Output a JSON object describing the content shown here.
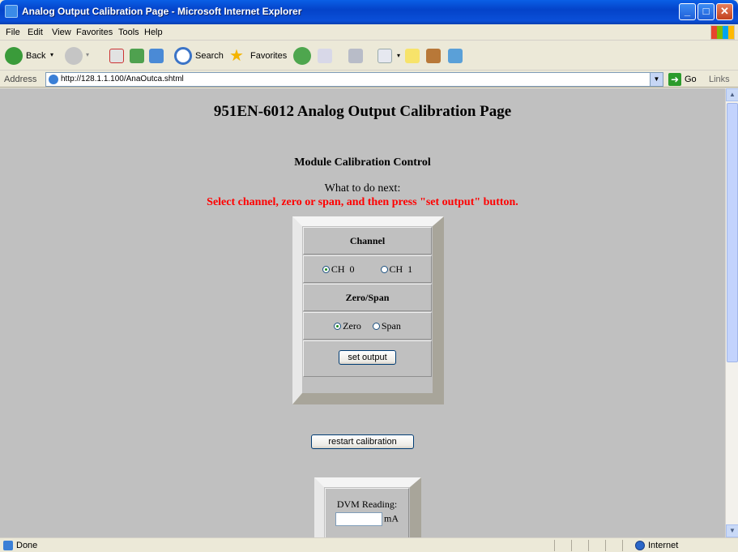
{
  "window": {
    "title": "Analog Output Calibration Page - Microsoft Internet Explorer",
    "minimize": "_",
    "maximize": "□",
    "close": "✕"
  },
  "menu": [
    "File",
    "Edit",
    "View",
    "Favorites",
    "Tools",
    "Help"
  ],
  "toolbar": {
    "back": "Back",
    "search": "Search",
    "favorites": "Favorites"
  },
  "address": {
    "label": "Address",
    "url": "http://128.1.1.100/AnaOutca.shtml",
    "go": "Go",
    "links": "Links"
  },
  "page": {
    "title": "951EN-6012 Analog Output Calibration Page",
    "section": "Module Calibration Control",
    "next_label": "What to do next:",
    "instruction": "Select channel, zero or span, and then press \"set output\" button.",
    "panel": {
      "channel_header": "Channel",
      "ch0": "CH  0",
      "ch1": "CH  1",
      "channel_selected": "CH  0",
      "zerospan_header": "Zero/Span",
      "zero": "Zero",
      "span": "Span",
      "zerospan_selected": "Zero",
      "set_output": "set output"
    },
    "restart": "restart calibration",
    "dvm": {
      "label": "DVM Reading:",
      "unit": "mA",
      "value": ""
    }
  },
  "status": {
    "text": "Done",
    "zone": "Internet"
  }
}
